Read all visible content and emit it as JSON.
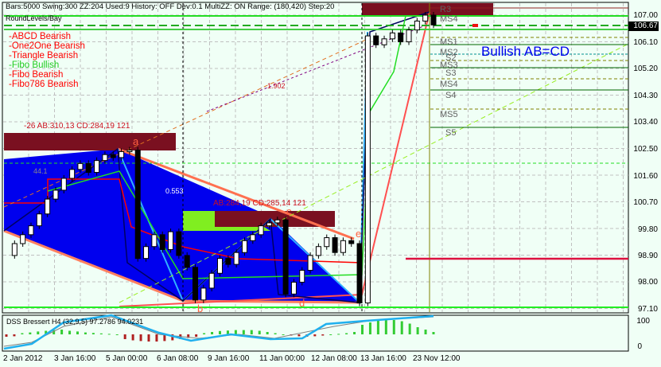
{
  "header": {
    "status": "Bars:5000  Swing:300  ZZ:204  Used:9  History: OFF  Dev:0.1  MultiZZ: ON  Range: (180,420)  Step:20",
    "sub": "RoundLevels/Bay"
  },
  "legend": [
    {
      "label": "-ABCD Bearish",
      "color": "#ff0000"
    },
    {
      "label": "-One2One Bearish",
      "color": "#ff0000"
    },
    {
      "label": "-Triangle Bearish",
      "color": "#ff0000"
    },
    {
      "label": "-Fibo Bullish",
      "color": "#22cc22"
    },
    {
      "label": "-Fibo Bearish",
      "color": "#ff0000"
    },
    {
      "label": "-Fibo786 Bearish",
      "color": "#ff0000"
    }
  ],
  "annotations": {
    "pattern1": "-26   AB:310,13 CD:284,19   121",
    "pattern2": "AB:284,19 CD:285,14   121",
    "fib1": "1.902",
    "fib2": "0.553",
    "fib3": "44.1",
    "bullish": "Bullish AB=CD",
    "point_a": "a",
    "point_b": "b",
    "point_c": "c",
    "point_d": "d",
    "point_e": "e"
  },
  "pivots": [
    "R3",
    "MS4",
    "MS1",
    "MS2",
    "S2",
    "MS3",
    "S3",
    "MS4",
    "S4",
    "MS5",
    "S5"
  ],
  "price_axis": {
    "labels": [
      "107.00",
      "106.10",
      "105.20",
      "104.30",
      "103.40",
      "102.50",
      "101.60",
      "100.70",
      "99.80",
      "98.90",
      "98.00",
      "97.10"
    ],
    "current": "106.67"
  },
  "indicator": {
    "title": "DSS Bressert H4 (32,9,5) 97.2786 94.0231",
    "labels": [
      "100",
      "0"
    ]
  },
  "time_axis": [
    "2 Jan 2012",
    "3 Jan 16:00",
    "5 Jan 00:00",
    "6 Jan 08:00",
    "9 Jan 16:00",
    "11 Jan 00:00",
    "12 Jan 08:00",
    "13 Jan 16:00",
    "23 Nov 12:00"
  ],
  "colors": {
    "bg": "#f0fff6",
    "bull": "#ffffff",
    "bear": "#000000",
    "pattern": "#0000ff",
    "zone": "#7a1020",
    "accent": "#ff0000"
  },
  "chart_data": {
    "type": "candlestick",
    "ylim": [
      97.1,
      107.0
    ],
    "closes": [
      98.9,
      99.3,
      99.6,
      99.9,
      100.3,
      100.8,
      101.1,
      101.5,
      101.8,
      102.0,
      101.7,
      102.1,
      102.3,
      102.2,
      102.4,
      102.45,
      98.8,
      99.2,
      99.6,
      99.1,
      99.7,
      98.9,
      98.5,
      97.4,
      97.8,
      98.3,
      98.8,
      98.6,
      99.0,
      99.4,
      99.6,
      99.9,
      100.0,
      100.1,
      97.6,
      98.0,
      98.4,
      98.9,
      99.2,
      99.5,
      99.0,
      99.4,
      99.3,
      97.3,
      106.3,
      106.0,
      106.2,
      106.4,
      106.1,
      106.5,
      106.8,
      107.0,
      106.67
    ],
    "histogram": [
      -10,
      -8,
      5,
      8,
      12,
      15,
      18,
      20,
      15,
      12,
      8,
      6,
      4,
      2,
      0,
      -20,
      -25,
      -28,
      -30,
      -30,
      -28,
      -25,
      -20,
      -15,
      -10,
      5,
      10,
      14,
      16,
      18,
      18,
      18,
      15,
      10,
      5,
      0,
      -5,
      -8,
      -10,
      -8,
      -5,
      0,
      2,
      5,
      10,
      40,
      50,
      60,
      62,
      60,
      55,
      45,
      30,
      20,
      10
    ]
  }
}
